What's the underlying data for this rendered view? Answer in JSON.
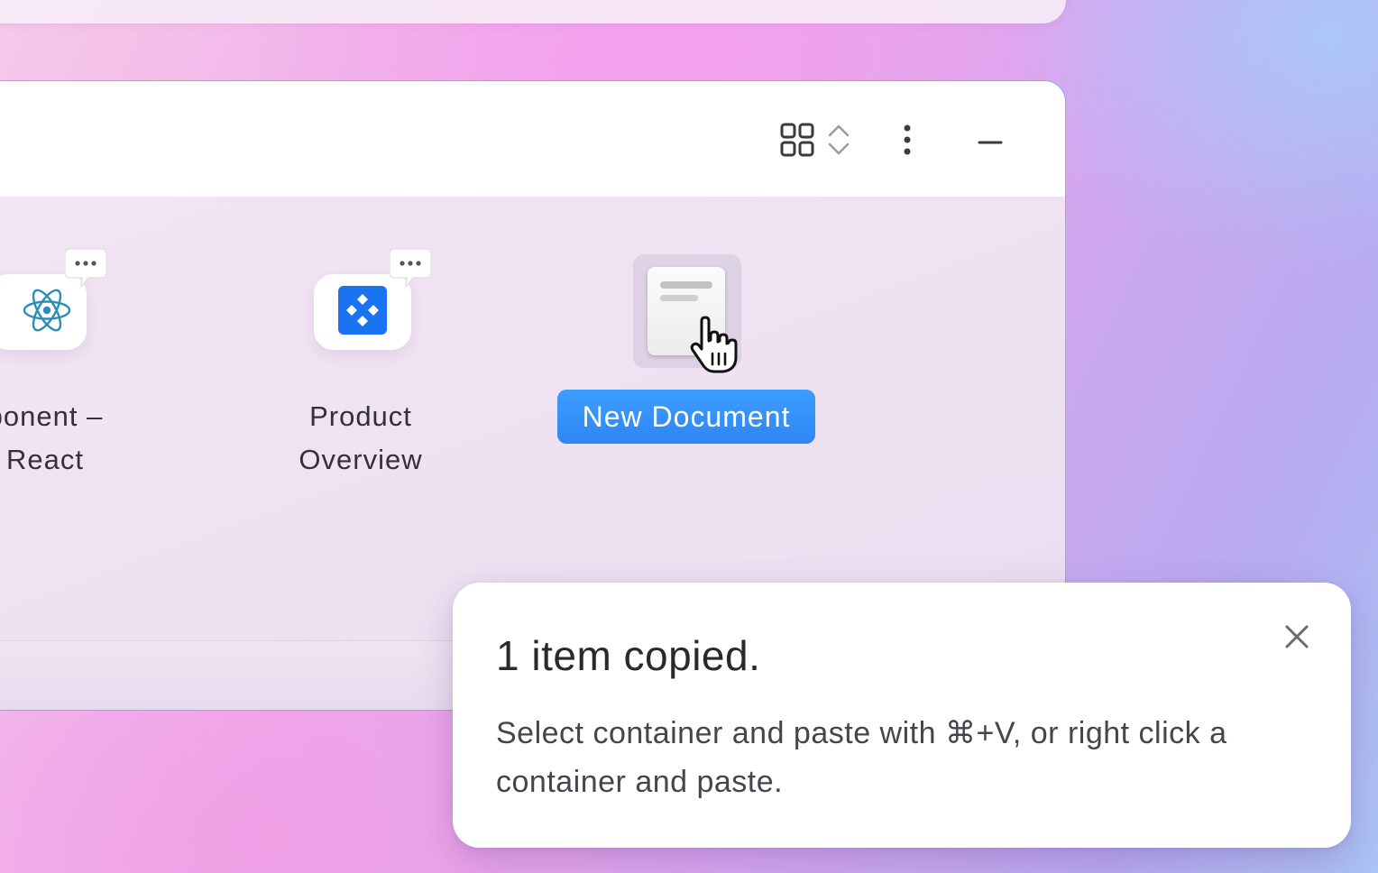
{
  "window": {
    "header": {
      "view_toggle_icon": "grid-icon",
      "sort_icon": "chevron-updown-icon",
      "more_icon": "more-vertical-icon",
      "minimize_icon": "minus-icon"
    },
    "items": [
      {
        "label": "ponent –\nReact",
        "icon": "react-icon",
        "has_comments": true
      },
      {
        "label": "Product\nOverview",
        "icon": "component-diamond-icon",
        "has_comments": true
      },
      {
        "label": "New Document",
        "icon": "document-icon",
        "selected": true,
        "editing": true
      }
    ]
  },
  "toast": {
    "title": "1 item copied.",
    "body": "Select container and paste with ⌘+V, or right click a container and paste.",
    "close_icon": "close-icon"
  },
  "colors": {
    "accent": "#2f86f5",
    "window_border": "#7bb2f0",
    "figma_blue": "#1a73f0",
    "react_teal": "#2c8db8"
  }
}
